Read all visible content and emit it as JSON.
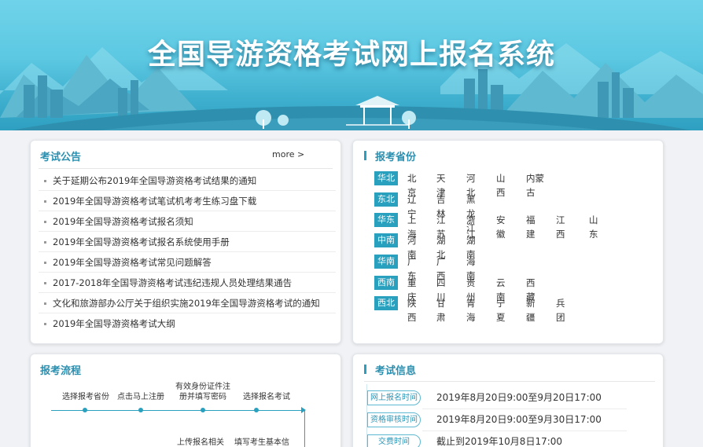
{
  "banner": {
    "title": "全国导游资格考试网上报名系统"
  },
  "notice": {
    "title": "考试公告",
    "more": "more >",
    "items": [
      "关于延期公布2019年全国导游资格考试结果的通知",
      "2019年全国导游资格考试笔试机考考生练习盘下载",
      "2019年全国导游资格考试报名须知",
      "2019年全国导游资格考试报名系统使用手册",
      "2019年全国导游资格考试常见问题解答",
      "2017-2018年全国导游资格考试违纪违规人员处理结果通告",
      "文化和旅游部办公厅关于组织实施2019年全国导游资格考试的通知",
      "2019年全国导游资格考试大纲"
    ]
  },
  "provinces": {
    "title": "报考省份",
    "regions": [
      {
        "name": "华北",
        "items": [
          "北京",
          "天津",
          "河北",
          "山西",
          "内蒙古"
        ]
      },
      {
        "name": "东北",
        "items": [
          "辽宁",
          "吉林",
          "黑龙江"
        ]
      },
      {
        "name": "华东",
        "items": [
          "上海",
          "江苏",
          "浙江",
          "安徽",
          "福建",
          "江西",
          "山东"
        ]
      },
      {
        "name": "中南",
        "items": [
          "河南",
          "湖北",
          "湖南"
        ]
      },
      {
        "name": "华南",
        "items": [
          "广东",
          "广西",
          "海南"
        ]
      },
      {
        "name": "西南",
        "items": [
          "重庆",
          "四川",
          "贵州",
          "云南",
          "西藏"
        ]
      },
      {
        "name": "西北",
        "items": [
          "陕西",
          "甘肃",
          "青海",
          "宁夏",
          "新疆",
          "兵团"
        ]
      }
    ]
  },
  "process": {
    "title": "报考流程",
    "steps_top": [
      "选择报考省份",
      "点击马上注册",
      "有效身份证件注册并填写密码",
      "选择报名考试"
    ],
    "steps_bottom": [
      "上传报名相关",
      "填写考生基本信"
    ]
  },
  "exam_info": {
    "title": "考试信息",
    "rows": [
      {
        "label": "网上报名时间",
        "value": "2019年8月20日9:00至9月20日17:00"
      },
      {
        "label": "资格审核时间",
        "value": "2019年8月20日9:00至9月30日17:00"
      },
      {
        "label": "交费时间",
        "value": "截止到2019年10月8日17:00"
      }
    ]
  },
  "colors": {
    "accent": "#2aa0bf",
    "title": "#2b8fb0"
  }
}
